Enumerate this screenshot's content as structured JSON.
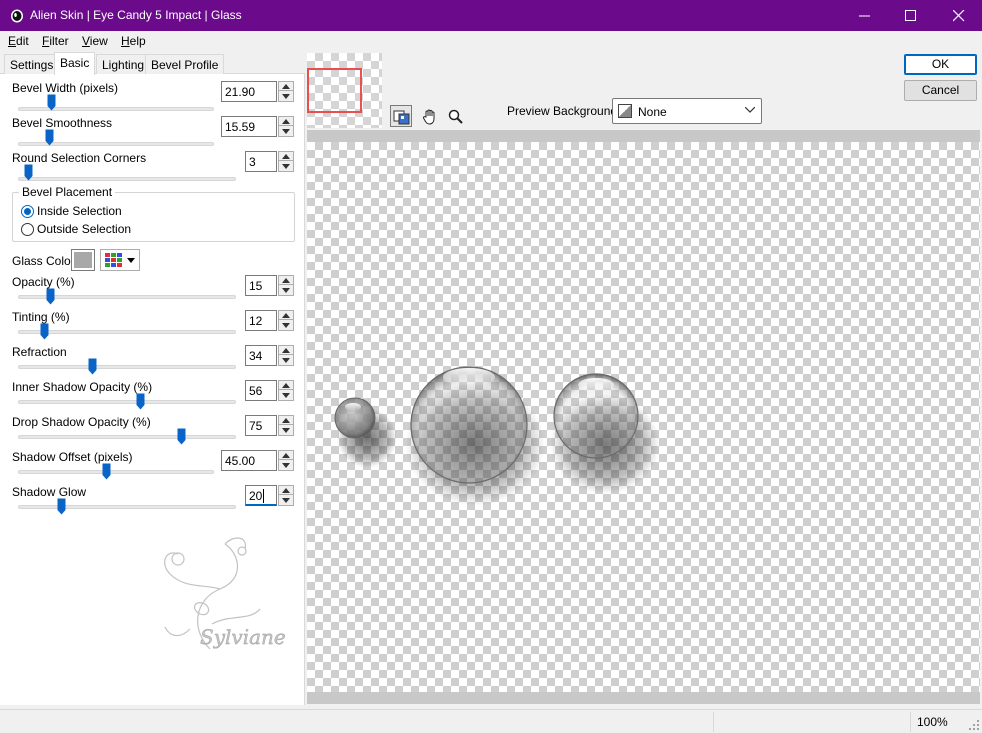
{
  "window": {
    "title": "Alien Skin | Eye Candy 5 Impact | Glass",
    "controls": {
      "minimize": "minimize",
      "maximize": "maximize",
      "close": "close"
    }
  },
  "menu": [
    {
      "label": "Edit",
      "mnemonic": "E",
      "rest": "dit"
    },
    {
      "label": "Filter",
      "mnemonic": "F",
      "rest": "ilter"
    },
    {
      "label": "View",
      "mnemonic": "V",
      "rest": "iew"
    },
    {
      "label": "Help",
      "mnemonic": "H",
      "rest": "elp"
    }
  ],
  "tabs": [
    {
      "label": "Settings",
      "active": false
    },
    {
      "label": "Basic",
      "active": true
    },
    {
      "label": "Lighting",
      "active": false
    },
    {
      "label": "Bevel Profile",
      "active": false
    }
  ],
  "params": {
    "bevel_width": {
      "label": "Bevel Width (pixels)",
      "value": "21.90",
      "level": 0.17
    },
    "bevel_smoothness": {
      "label": "Bevel Smoothness",
      "value": "15.59",
      "level": 0.16
    },
    "round_corners": {
      "label": "Round Selection Corners",
      "value": "3",
      "level": 0.05
    },
    "bevel_placement": {
      "label": "Bevel Placement",
      "options": [
        "Inside Selection",
        "Outside Selection"
      ],
      "selected": "Inside Selection"
    },
    "glass_color": {
      "label": "Glass Color",
      "swatch": "#a8a8a8"
    },
    "opacity": {
      "label": "Opacity (%)",
      "value": "15",
      "level": 0.15
    },
    "tinting": {
      "label": "Tinting (%)",
      "value": "12",
      "level": 0.12
    },
    "refraction": {
      "label": "Refraction",
      "value": "34",
      "level": 0.34
    },
    "inner_shadow_opacity": {
      "label": "Inner Shadow Opacity (%)",
      "value": "56",
      "level": 0.56
    },
    "drop_shadow_opacity": {
      "label": "Drop Shadow Opacity (%)",
      "value": "75",
      "level": 0.75
    },
    "shadow_offset": {
      "label": "Shadow Offset (pixels)",
      "value": "45.00",
      "level": 0.45
    },
    "shadow_glow": {
      "label": "Shadow Glow",
      "value": "20",
      "level": 0.2
    }
  },
  "preview": {
    "background_label": "Preview Background:",
    "background_value": "None",
    "tools": [
      "preview-toggle-icon",
      "hand-icon",
      "zoom-icon"
    ]
  },
  "buttons": {
    "ok": "OK",
    "cancel": "Cancel"
  },
  "status": {
    "zoom": "100%"
  },
  "watermark_text": "Sylviane",
  "colors": {
    "titlebar": "#6b0b8c",
    "accent": "#0067c0",
    "thumb": "#0a64c8"
  }
}
